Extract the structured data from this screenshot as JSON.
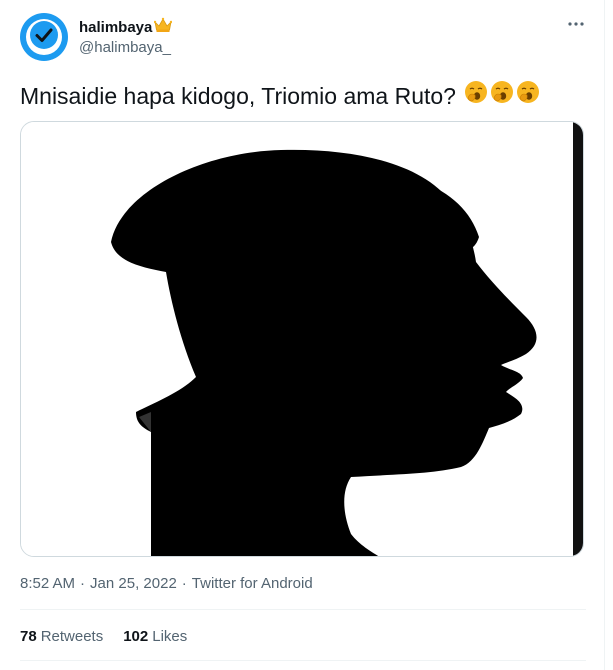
{
  "user": {
    "display_name": "halimbaya",
    "handle": "@halimbaya_",
    "badge_icon": "crown-icon",
    "avatar_icon": "checkmark-icon",
    "avatar_color": "#1d9bf0"
  },
  "tweet": {
    "text": "Mnisaidie hapa kidogo, Triomio ama Ruto?",
    "emojis": [
      "yawning-face-icon",
      "yawning-face-icon",
      "yawning-face-icon"
    ],
    "media_description_icon": "silhouette-image"
  },
  "meta": {
    "time": "8:52 AM",
    "separator": "·",
    "date": "Jan 25, 2022",
    "source": "Twitter for Android"
  },
  "stats": {
    "retweets_count": "78",
    "retweets_label": "Retweets",
    "likes_count": "102",
    "likes_label": "Likes"
  },
  "colors": {
    "text_primary": "#0f1419",
    "text_secondary": "#536471",
    "accent": "#1d9bf0",
    "emoji": "#f7b520"
  }
}
